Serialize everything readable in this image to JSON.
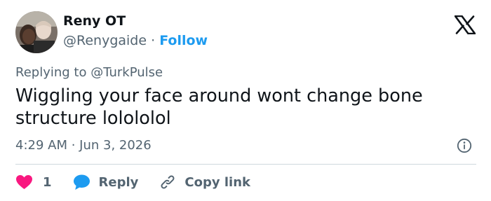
{
  "author": {
    "name": "Reny OT",
    "handle": "@Renygaide",
    "separator": "·",
    "follow_label": "Follow"
  },
  "reply_context": {
    "prefix": "Replying to",
    "mention": "@TurkPulse"
  },
  "tweet": {
    "text": "Wiggling your face around wont change bone structure lolololol",
    "timestamp": "4:29 AM · Jun 3, 2026"
  },
  "actions": {
    "like_count": "1",
    "reply_label": "Reply",
    "copy_link_label": "Copy link"
  },
  "icons": {
    "brand": "x-logo-icon",
    "info": "info-icon",
    "like": "heart-icon",
    "reply": "speech-bubble-icon",
    "copy": "link-icon"
  },
  "colors": {
    "accent": "#1d9bf0",
    "like": "#f91880",
    "text_primary": "#0f1419",
    "text_secondary": "#536471",
    "divider": "#cfd9de"
  }
}
